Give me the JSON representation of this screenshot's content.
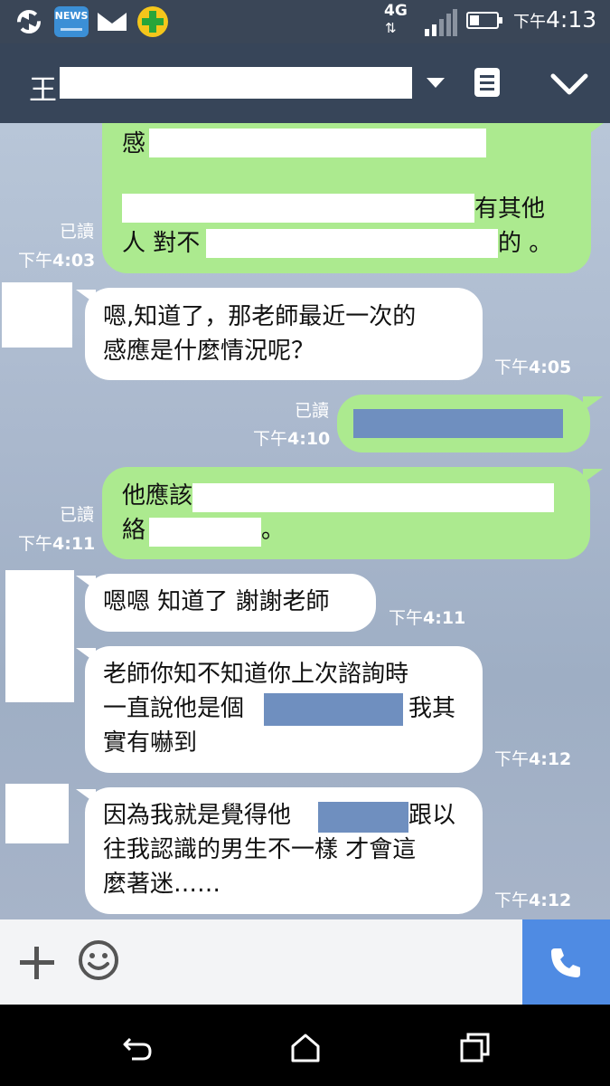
{
  "status_bar": {
    "network": "4G",
    "network_arrows": "⇅",
    "time_ampm": "下午",
    "time": "4:13",
    "news_label": "NEWS",
    "icons": [
      "sync-icon",
      "news-icon",
      "mail-icon",
      "plus-app-icon",
      "signal-icon",
      "battery-icon"
    ]
  },
  "header": {
    "name_visible": "王",
    "icons": [
      "dropdown-icon",
      "notes-icon",
      "chevron-down-icon"
    ]
  },
  "messages": [
    {
      "side": "out",
      "lines": [
        "感",
        "",
        "有其他",
        "人 對不",
        "的 。"
      ],
      "read": "已讀",
      "time_ampm": "下午",
      "time": "4:03"
    },
    {
      "side": "in",
      "lines": [
        "嗯,知道了，那老師最近一次的",
        "感應是什麼情況呢？"
      ],
      "time_ampm": "下午",
      "time": "4:05"
    },
    {
      "side": "out",
      "lines": [
        ""
      ],
      "read": "已讀",
      "time_ampm": "下午",
      "time": "4:10"
    },
    {
      "side": "out",
      "lines": [
        "他應該",
        "絡",
        "。"
      ],
      "read": "已讀",
      "time_ampm": "下午",
      "time": "4:11"
    },
    {
      "side": "in",
      "lines": [
        "嗯嗯 知道了 謝謝老師"
      ],
      "time_ampm": "下午",
      "time": "4:11"
    },
    {
      "side": "in",
      "lines": [
        "老師你知不知道你上次諮詢時",
        "一直說他是個",
        "我其",
        "實有嚇到"
      ],
      "time_ampm": "下午",
      "time": "4:12"
    },
    {
      "side": "in",
      "lines": [
        "因為我就是覺得他",
        "跟以",
        "往我認識的男生不一樣 才會這",
        "麼著迷……"
      ],
      "time_ampm": "下午",
      "time": "4:12"
    }
  ],
  "input_bar": {
    "icons": [
      "plus-icon",
      "emoji-icon",
      "phone-icon"
    ]
  },
  "nav_bar": {
    "icons": [
      "back-icon",
      "home-icon",
      "recents-icon"
    ]
  },
  "colors": {
    "header_bg": "#374559",
    "bubble_out": "#acea8f",
    "bubble_in": "#ffffff",
    "call_button": "#4f8be3",
    "redaction_blue": "#6f8fbf"
  }
}
